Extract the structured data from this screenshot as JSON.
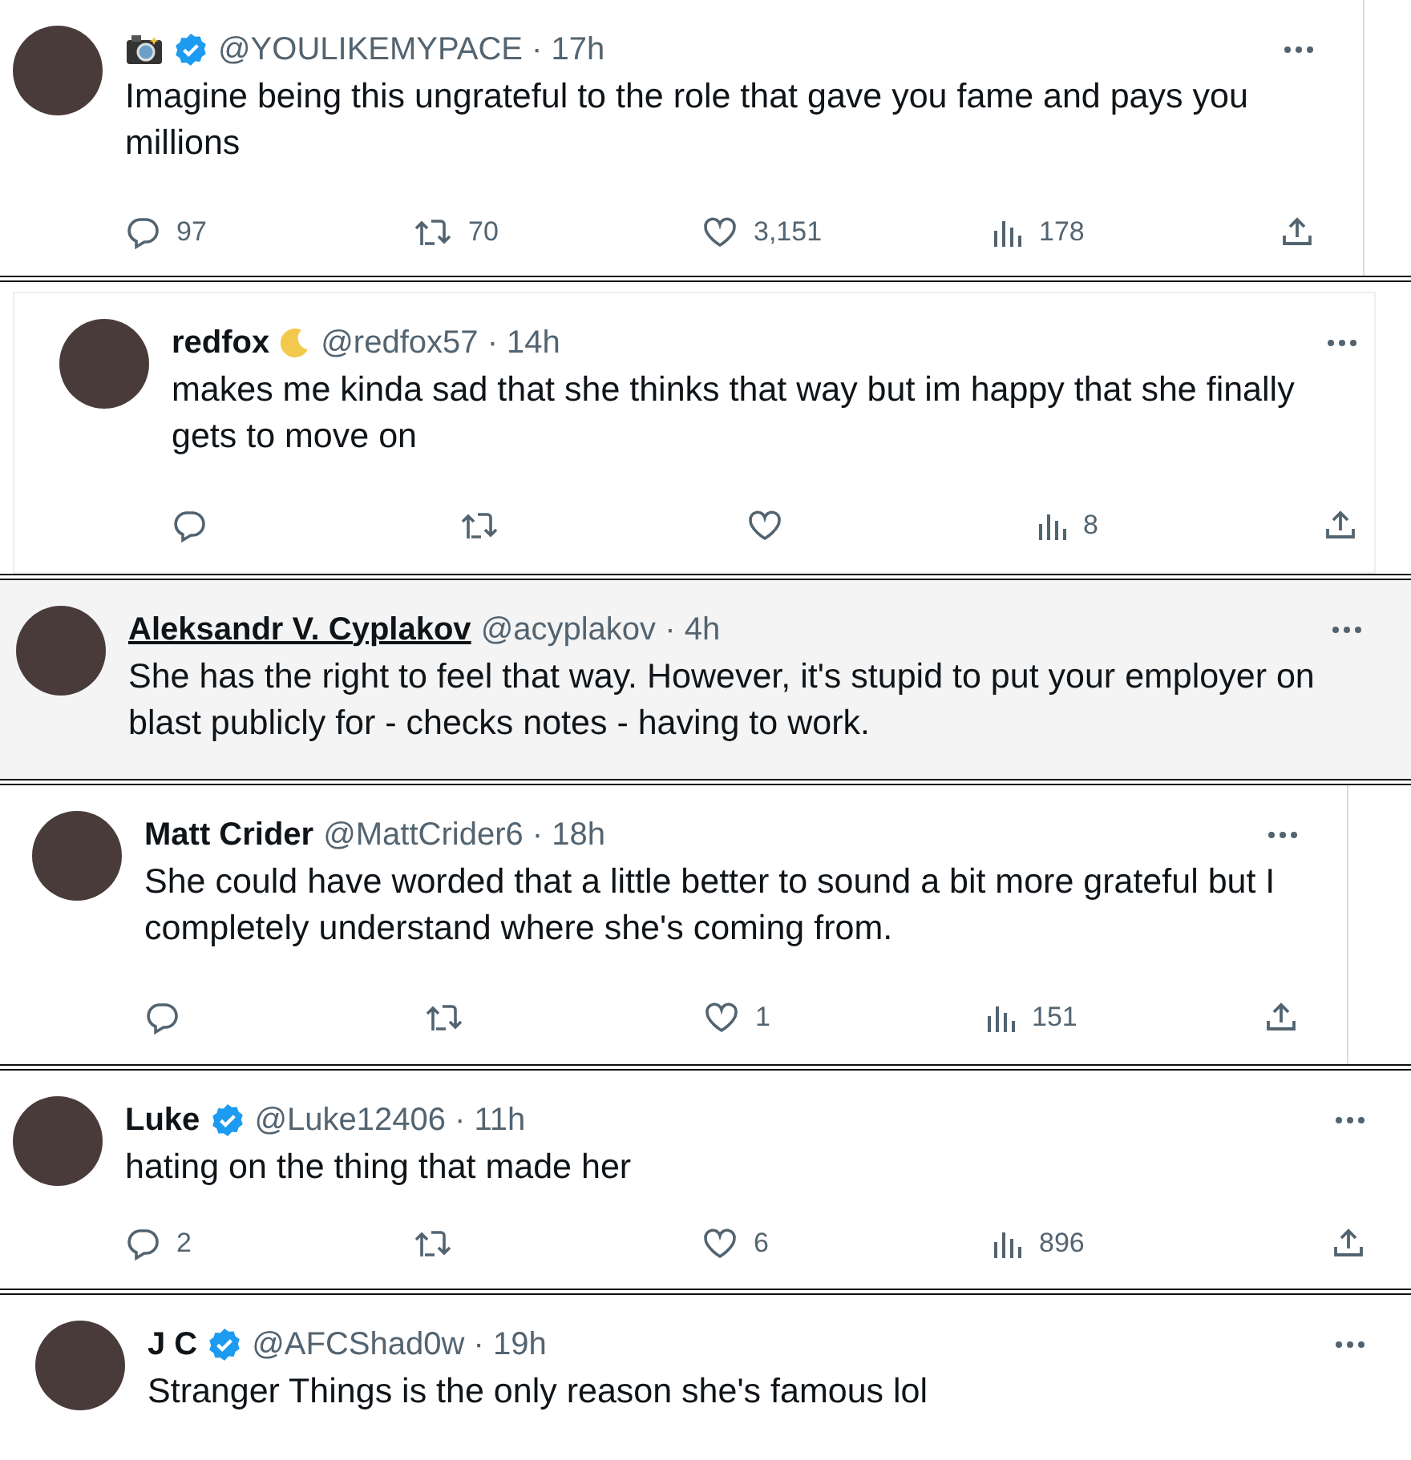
{
  "tweets": [
    {
      "camera_emoji": true,
      "verified": true,
      "handle_time": "@YOULIKEMYPACE · 17h",
      "text": "Imagine being this ungrateful to the role that gave you fame and pays you millions",
      "hovered": false,
      "replies": "97",
      "reposts": "70",
      "likes": "3,151",
      "views": "178"
    },
    {
      "name": "redfox",
      "moon_emoji": true,
      "verified": false,
      "handle_time": "@redfox57 · 14h",
      "text": "makes me kinda sad that she thinks that way but im happy that she finally gets to move on",
      "hovered": false,
      "views": "8"
    },
    {
      "name": "Aleksandr V. Cyplakov",
      "verified": false,
      "handle_time": "@acyplakov · 4h",
      "text": "She has the right to feel that way. However, it's stupid to put your employer on blast publicly for - checks notes - having to work.",
      "hovered": true
    },
    {
      "name": "Matt Crider",
      "verified": false,
      "handle_time": "@MattCrider6 · 18h",
      "text": "She could have worded that a little better to sound a bit more grateful but I completely understand where she's coming from.",
      "hovered": false,
      "likes": "1",
      "views": "151"
    },
    {
      "name": "Luke",
      "verified": true,
      "handle_time": "@Luke12406 · 11h",
      "text": "hating on the thing that made her",
      "hovered": false,
      "replies": "2",
      "likes": "6",
      "views": "896"
    },
    {
      "name": "J C",
      "verified": true,
      "handle_time": "@AFCShad0w · 19h",
      "text": "Stranger Things is the only reason she's famous lol",
      "hovered": false
    }
  ]
}
